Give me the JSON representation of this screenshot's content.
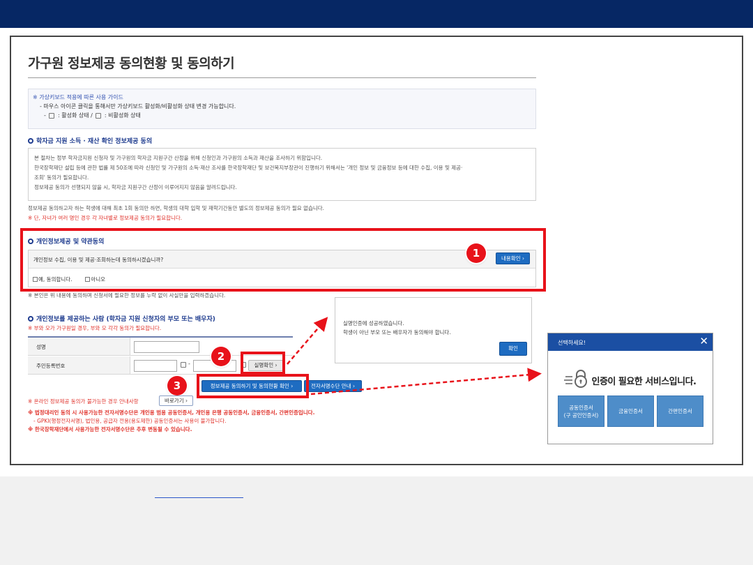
{
  "page": {
    "title": "가구원 정보제공 동의현황 및 동의하기"
  },
  "guide": {
    "heading": "※ 가상키보드 적용에 따른 사용 가이드",
    "line1": "- 마우스 아이콘 클릭을 통해서만 가상키보드 활성화/비활성화 상태 변경 가능합니다.",
    "active_label": ": 활성화 상태 /",
    "inactive_label": ": 비활성화 상태"
  },
  "section1": {
    "heading": "학자금 지원 소득 · 재산 확인 정보제공 동의",
    "lines": [
      "본 절차는 정부 학자금지원 신청자 및 가구원의 학자금 지원구간 산정을 위해 신청인과 가구원의 소득과 재산을 조사하기 위함입니다.",
      "한국장학재단 설립 등에 관한 법률 제 50조에 따라 신청인 및 가구원의 소득·재산 조사를 한국장학재단 및 보건복지부장관이 진행하기 위해서는 '개인 정보 및 금융정보 등에 대한 수집, 이용 및 제공·",
      "조회' 동의가 필요합니다.",
      "정보제공 동의가 선행되지 않을 시, 학자금 지원구간 산정이 이루어지지 않음을 알려드립니다."
    ],
    "note1": "정보제공 동의하고자 하는 학생에 대해 최초 1회 동의만 하면, 학생의 대학 입학 및 재학기간동안 별도의 정보제공 동의가 필요 없습니다.",
    "note2": "※ 단, 자녀가 여러 명인 경우 각 자녀별로 정보제공 동의가 필요합니다."
  },
  "section2": {
    "heading": "개인정보제공 및 약관동의",
    "question": "개인정보 수집, 이용 및 제공·조회하는데 동의하시겠습니까?",
    "details_button": "내용확인 ›",
    "agree_label": "예, 동의합니다.",
    "disagree_label": "아니오",
    "note": "※ 본인은 위 내용에 동의하며 신청서에 필요한 정보를 누락 없이 사실만을 입력하겠습니다."
  },
  "section3": {
    "heading": "개인정보를 제공하는 사람 (학자금 지원 신청자의 부모 또는 배우자)",
    "note": "※ 부와 모가 가구원일 경우, 부와 모 각각 동의가 필요합니다.",
    "name_label": "성명",
    "name_value": "",
    "rrn_label": "주민등록번호",
    "rrn_front": "",
    "rrn_back": "",
    "rrn_dash": "-",
    "verify_button": "실명확인 ›",
    "consent_button": "정보제공 동의하기 및 동의현황 확인 ›",
    "esign_button": "전자서명수단 안내 ›",
    "goto_button": "바로가기 ›"
  },
  "bottom_notes": {
    "online_unavailable": "※ 온라인 정보제공 동의가 불가능한 경우 안내사항",
    "legal_rep": "※ 법정대리인 동의 시 사용가능한 전자서명수단은 개인용 범용 공동인증서, 개인용 은행 공동인증서, 금융인증서, 간편인증입니다.",
    "gpki": "- GPKI(행정전자서명), 법인용, 공급자 전용(용도제한) 공동인증서는 사용이 불가합니다.",
    "subject_to_change": "※ 한국장학재단에서 사용가능한 전자서명수단은 추후 변동될 수 있습니다."
  },
  "verify_panel": {
    "line1": "실명인증에 성공하였습니다.",
    "line2": "학생이 아닌 부모 또는 배우자가 동의해야 합니다.",
    "ok_button": "확인"
  },
  "cert_popup": {
    "title": "선택하세요!",
    "message": "인증이 필요한 서비스입니다.",
    "btn_public": "공동인증서",
    "btn_public_sub": "(구 공인인증서)",
    "btn_financial": "금융인증서",
    "btn_simple": "간편인증서"
  },
  "badges": {
    "b1": "1",
    "b2": "2",
    "b3": "3"
  },
  "colors": {
    "top_bar": "#062764",
    "highlight": "#e8121a",
    "accent_blue": "#1e6cc1",
    "popup_header": "#1b4fa3",
    "cert_button": "#4e8dc9"
  }
}
